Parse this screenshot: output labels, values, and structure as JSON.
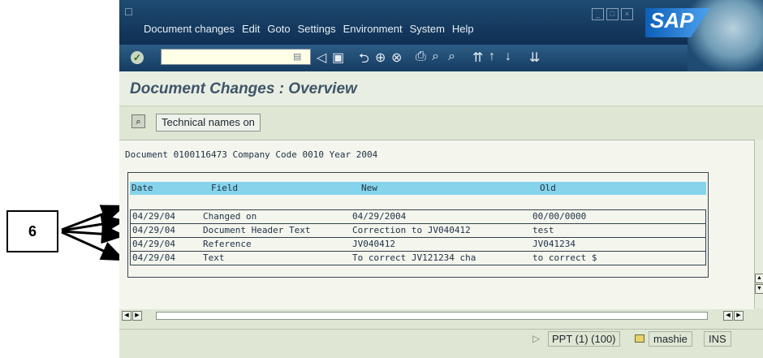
{
  "callout": {
    "label": "6"
  },
  "menubar": {
    "items": [
      "Document changes",
      "Edit",
      "Goto",
      "Settings",
      "Environment",
      "System",
      "Help"
    ]
  },
  "logo": {
    "text": "SAP"
  },
  "page": {
    "title": "Document Changes : Overview"
  },
  "app_toolbar": {
    "tech_names_label": "Technical names on"
  },
  "document_line": "Document 0100116473 Company Code 0010 Year 2004",
  "table": {
    "headers": [
      "Date",
      "Field",
      "New",
      "Old"
    ],
    "rows": [
      [
        "04/29/04",
        "Changed on",
        "04/29/2004",
        "00/00/0000"
      ],
      [
        "04/29/04",
        "Document Header Text",
        "Correction to JV040412",
        "test"
      ],
      [
        "04/29/04",
        "Reference",
        "JV040412",
        "JV041234"
      ],
      [
        "04/29/04",
        "Text",
        "To correct JV121234 cha",
        "to correct $"
      ]
    ]
  },
  "status": {
    "system": "PPT (1) (100)",
    "user": "mashie",
    "mode": "INS"
  }
}
